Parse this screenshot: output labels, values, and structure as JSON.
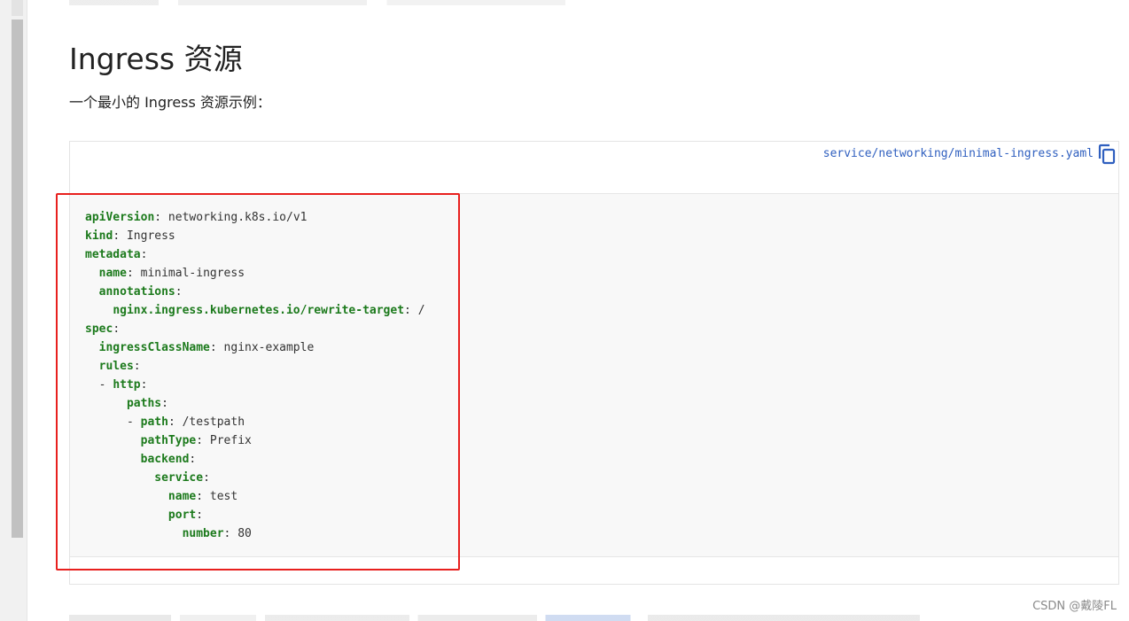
{
  "heading": "Ingress 资源",
  "intro": "一个最小的 Ingress 资源示例：",
  "code": {
    "file_link": "service/networking/minimal-ingress.yaml",
    "copy_icon": "copy-icon",
    "lines": [
      {
        "indent": "",
        "key": "apiVersion",
        "value": " networking.k8s.io/v1"
      },
      {
        "indent": "",
        "key": "kind",
        "value": " Ingress"
      },
      {
        "indent": "",
        "key": "metadata",
        "value": ""
      },
      {
        "indent": "  ",
        "key": "name",
        "value": " minimal-ingress"
      },
      {
        "indent": "  ",
        "key": "annotations",
        "value": ""
      },
      {
        "indent": "    ",
        "key": "nginx.ingress.kubernetes.io/rewrite-target",
        "value": " /"
      },
      {
        "indent": "",
        "key": "spec",
        "value": ""
      },
      {
        "indent": "  ",
        "key": "ingressClassName",
        "value": " nginx-example"
      },
      {
        "indent": "  ",
        "key": "rules",
        "value": ""
      },
      {
        "indent": "  - ",
        "key": "http",
        "value": ""
      },
      {
        "indent": "      ",
        "key": "paths",
        "value": ""
      },
      {
        "indent": "      - ",
        "key": "path",
        "value": " /testpath"
      },
      {
        "indent": "        ",
        "key": "pathType",
        "value": " Prefix"
      },
      {
        "indent": "        ",
        "key": "backend",
        "value": ""
      },
      {
        "indent": "          ",
        "key": "service",
        "value": ""
      },
      {
        "indent": "            ",
        "key": "name",
        "value": " test"
      },
      {
        "indent": "            ",
        "key": "port",
        "value": ""
      },
      {
        "indent": "              ",
        "key": "number",
        "value": " 80"
      }
    ]
  },
  "watermark": "CSDN @戴陵FL",
  "colors": {
    "yaml_key": "#1c7a1c",
    "link": "#2f5fbf",
    "highlight": "#e8201e",
    "code_bg": "#f8f8f8"
  }
}
